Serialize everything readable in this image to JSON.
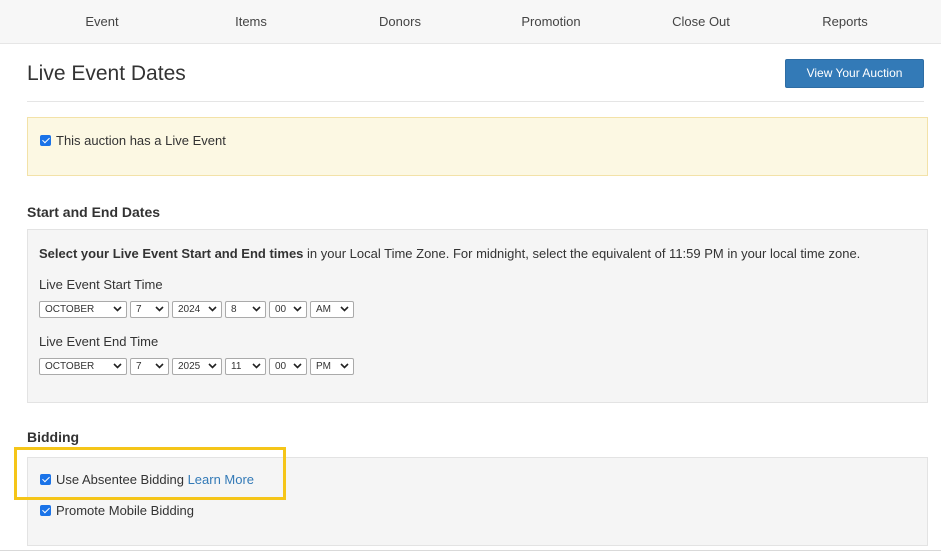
{
  "nav": {
    "items": [
      {
        "label": "Event"
      },
      {
        "label": "Items"
      },
      {
        "label": "Donors"
      },
      {
        "label": "Promotion"
      },
      {
        "label": "Close Out"
      },
      {
        "label": "Reports"
      }
    ]
  },
  "header": {
    "title": "Live Event Dates",
    "view_button": "View Your Auction"
  },
  "live_event": {
    "checked": true,
    "label": "This auction has a Live Event"
  },
  "dates": {
    "heading": "Start and End Dates",
    "intro_bold": "Select your Live Event Start and End times",
    "intro_rest": " in your Local Time Zone. For midnight, select the equivalent of 11:59 PM in your local time zone.",
    "start": {
      "label": "Live Event Start Time",
      "month": "OCTOBER",
      "day": "7",
      "year": "2024",
      "hour": "8",
      "minute": "00",
      "ampm": "AM"
    },
    "end": {
      "label": "Live Event End Time",
      "month": "OCTOBER",
      "day": "7",
      "year": "2025",
      "hour": "11",
      "minute": "00",
      "ampm": "PM"
    }
  },
  "bidding": {
    "heading": "Bidding",
    "absentee": {
      "checked": true,
      "label": "Use Absentee Bidding",
      "link": "Learn More"
    },
    "mobile": {
      "checked": true,
      "label": "Promote Mobile Bidding"
    }
  },
  "colors": {
    "primary_button": "#337ab7",
    "alert_background": "#fcf8e3",
    "highlight_border": "#f5c518",
    "checkbox": "#1a73e8"
  },
  "icons": {
    "checkbox": "checkbox-checked-icon",
    "select_arrow": "chevron-down-icon"
  }
}
